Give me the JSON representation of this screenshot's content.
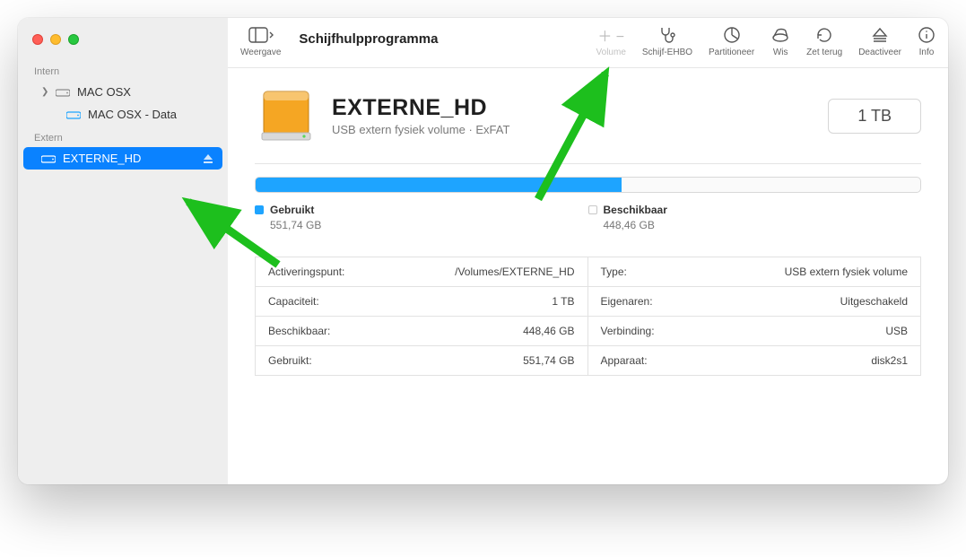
{
  "app_title": "Schijfhulpprogramma",
  "toolbar": {
    "view": "Weergave",
    "volume": "Volume",
    "first_aid": "Schijf-EHBO",
    "partition": "Partitioneer",
    "erase": "Wis",
    "restore": "Zet terug",
    "unmount": "Deactiveer",
    "info": "Info"
  },
  "sidebar": {
    "internal_label": "Intern",
    "external_label": "Extern",
    "internal": [
      {
        "name": "MAC OSX",
        "children": [
          {
            "name": "MAC OSX - Data"
          }
        ]
      }
    ],
    "external": [
      {
        "name": "EXTERNE_HD",
        "selected": true,
        "ejectable": true
      }
    ]
  },
  "volume": {
    "name": "EXTERNE_HD",
    "subtitle": "USB extern fysiek volume · ExFAT",
    "capacity_badge": "1 TB",
    "usage": {
      "used_label": "Gebruikt",
      "used_value": "551,74 GB",
      "free_label": "Beschikbaar",
      "free_value": "448,46 GB",
      "used_percent": 55
    },
    "info": [
      {
        "k": "Activeringspunt:",
        "v": "/Volumes/EXTERNE_HD"
      },
      {
        "k": "Type:",
        "v": "USB extern fysiek volume"
      },
      {
        "k": "Capaciteit:",
        "v": "1 TB"
      },
      {
        "k": "Eigenaren:",
        "v": "Uitgeschakeld"
      },
      {
        "k": "Beschikbaar:",
        "v": "448,46 GB"
      },
      {
        "k": "Verbinding:",
        "v": "USB"
      },
      {
        "k": "Gebruikt:",
        "v": "551,74 GB"
      },
      {
        "k": "Apparaat:",
        "v": "disk2s1"
      }
    ]
  }
}
